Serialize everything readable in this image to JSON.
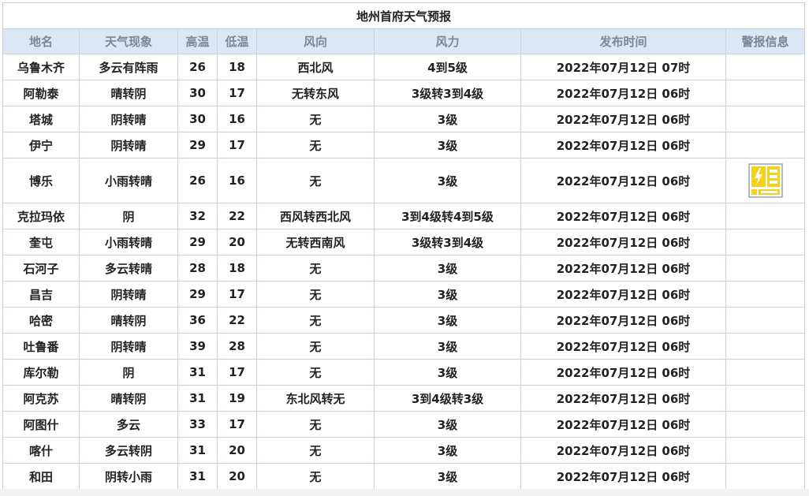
{
  "table": {
    "title": "地州首府天气预报",
    "headers": [
      "地名",
      "天气现象",
      "高温",
      "低温",
      "风向",
      "风力",
      "发布时间",
      "警报信息"
    ],
    "rows": [
      {
        "place": "乌鲁木齐",
        "weather": "多云有阵雨",
        "high": "26",
        "low": "18",
        "wind_dir": "西北风",
        "wind_force": "4到5级",
        "time": "2022年07月12日 07时",
        "alert": ""
      },
      {
        "place": "阿勒泰",
        "weather": "晴转阴",
        "high": "30",
        "low": "17",
        "wind_dir": "无转东风",
        "wind_force": "3级转3到4级",
        "time": "2022年07月12日 06时",
        "alert": ""
      },
      {
        "place": "塔城",
        "weather": "阴转晴",
        "high": "30",
        "low": "16",
        "wind_dir": "无",
        "wind_force": "3级",
        "time": "2022年07月12日 06时",
        "alert": ""
      },
      {
        "place": "伊宁",
        "weather": "阴转晴",
        "high": "29",
        "low": "17",
        "wind_dir": "无",
        "wind_force": "3级",
        "time": "2022年07月12日 06时",
        "alert": ""
      },
      {
        "place": "博乐",
        "weather": "小雨转晴",
        "high": "26",
        "low": "16",
        "wind_dir": "无",
        "wind_force": "3级",
        "time": "2022年07月12日 06时",
        "alert": "lightning-warning-icon"
      },
      {
        "place": "克拉玛依",
        "weather": "阴",
        "high": "32",
        "low": "22",
        "wind_dir": "西风转西北风",
        "wind_force": "3到4级转4到5级",
        "time": "2022年07月12日 06时",
        "alert": ""
      },
      {
        "place": "奎屯",
        "weather": "小雨转晴",
        "high": "29",
        "low": "20",
        "wind_dir": "无转西南风",
        "wind_force": "3级转3到4级",
        "time": "2022年07月12日 06时",
        "alert": ""
      },
      {
        "place": "石河子",
        "weather": "多云转晴",
        "high": "28",
        "low": "18",
        "wind_dir": "无",
        "wind_force": "3级",
        "time": "2022年07月12日 06时",
        "alert": ""
      },
      {
        "place": "昌吉",
        "weather": "阴转晴",
        "high": "29",
        "low": "17",
        "wind_dir": "无",
        "wind_force": "3级",
        "time": "2022年07月12日 06时",
        "alert": ""
      },
      {
        "place": "哈密",
        "weather": "晴转阴",
        "high": "36",
        "low": "22",
        "wind_dir": "无",
        "wind_force": "3级",
        "time": "2022年07月12日 06时",
        "alert": ""
      },
      {
        "place": "吐鲁番",
        "weather": "阴转晴",
        "high": "39",
        "low": "28",
        "wind_dir": "无",
        "wind_force": "3级",
        "time": "2022年07月12日 06时",
        "alert": ""
      },
      {
        "place": "库尔勒",
        "weather": "阴",
        "high": "31",
        "low": "17",
        "wind_dir": "无",
        "wind_force": "3级",
        "time": "2022年07月12日 06时",
        "alert": ""
      },
      {
        "place": "阿克苏",
        "weather": "晴转阴",
        "high": "31",
        "low": "19",
        "wind_dir": "东北风转无",
        "wind_force": "3到4级转3级",
        "time": "2022年07月12日 06时",
        "alert": ""
      },
      {
        "place": "阿图什",
        "weather": "多云",
        "high": "33",
        "low": "17",
        "wind_dir": "无",
        "wind_force": "3级",
        "time": "2022年07月12日 06时",
        "alert": ""
      },
      {
        "place": "喀什",
        "weather": "多云转阴",
        "high": "31",
        "low": "20",
        "wind_dir": "无",
        "wind_force": "3级",
        "time": "2022年07月12日 06时",
        "alert": ""
      },
      {
        "place": "和田",
        "weather": "阴转小雨",
        "high": "31",
        "low": "20",
        "wind_dir": "无",
        "wind_force": "3级",
        "time": "2022年07月12日 06时",
        "alert": ""
      }
    ]
  },
  "colors": {
    "header_bg": "#dbe7f5",
    "header_text": "#7a8799",
    "border": "#c8d3e2",
    "alert_yellow": "#f3d21a"
  }
}
